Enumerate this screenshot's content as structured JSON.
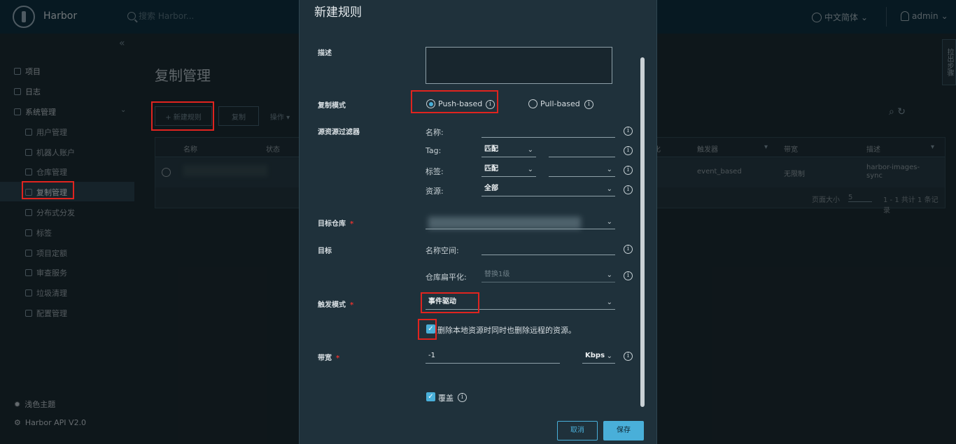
{
  "header": {
    "brand": "Harbor",
    "search_placeholder": "搜索 Harbor...",
    "language": "中文简体",
    "user": "admin"
  },
  "sidebar": {
    "items": [
      {
        "label": "项目",
        "icon": "projects-icon"
      },
      {
        "label": "日志",
        "icon": "logs-icon"
      },
      {
        "label": "系统管理",
        "icon": "admin-icon"
      }
    ],
    "subitems": [
      {
        "label": "用户管理",
        "icon": "users-icon"
      },
      {
        "label": "机器人账户",
        "icon": "robot-icon"
      },
      {
        "label": "仓库管理",
        "icon": "registry-icon"
      },
      {
        "label": "复制管理",
        "icon": "replication-icon"
      },
      {
        "label": "分布式分发",
        "icon": "distribution-icon"
      },
      {
        "label": "标签",
        "icon": "tag-icon"
      },
      {
        "label": "项目定额",
        "icon": "quota-icon"
      },
      {
        "label": "审查服务",
        "icon": "shield-icon"
      },
      {
        "label": "垃圾清理",
        "icon": "trash-icon"
      },
      {
        "label": "配置管理",
        "icon": "gear-icon"
      }
    ],
    "theme": "浅色主题",
    "api": "Harbor API V2.0"
  },
  "main": {
    "title": "复制管理",
    "buttons": {
      "new_rule": "+ 新建规则",
      "copy": "复制",
      "actions": "操作 ▾"
    },
    "table": {
      "headers": [
        "名称",
        "状态",
        "化",
        "触发器",
        "带宽",
        "描述"
      ],
      "row": {
        "trigger": "event_based",
        "bandwidth": "无限制",
        "description": "harbor-images-sync"
      },
      "page_size_label": "页面大小",
      "page_size": "5",
      "summary": "1 - 1 共计 1 条记录"
    },
    "side_tab": "拉出步骤"
  },
  "modal": {
    "title": "新建规则",
    "description_label": "描述",
    "mode_label": "复制模式",
    "push_label": "Push-based",
    "pull_label": "Pull-based",
    "filter_label": "源资源过滤器",
    "filter_name": "名称:",
    "filter_tag": "Tag:",
    "filter_tag_value": "匹配",
    "filter_label_lbl": "标签:",
    "filter_label_value": "匹配",
    "filter_resource": "资源:",
    "filter_resource_value": "全部",
    "target_registry_label": "目标仓库",
    "target_label": "目标",
    "namespace_label": "名称空间:",
    "flatten_label": "仓库扁平化:",
    "flatten_placeholder": "替换1级",
    "trigger_label": "触发模式",
    "trigger_value": "事件驱动",
    "delete_remote_label": "删除本地资源时同时也删除远程的资源。",
    "bandwidth_label": "带宽",
    "bandwidth_value": "-1",
    "bandwidth_unit": "Kbps",
    "override_label": "覆盖",
    "cancel": "取消",
    "save": "保存",
    "required_mark": "*"
  }
}
